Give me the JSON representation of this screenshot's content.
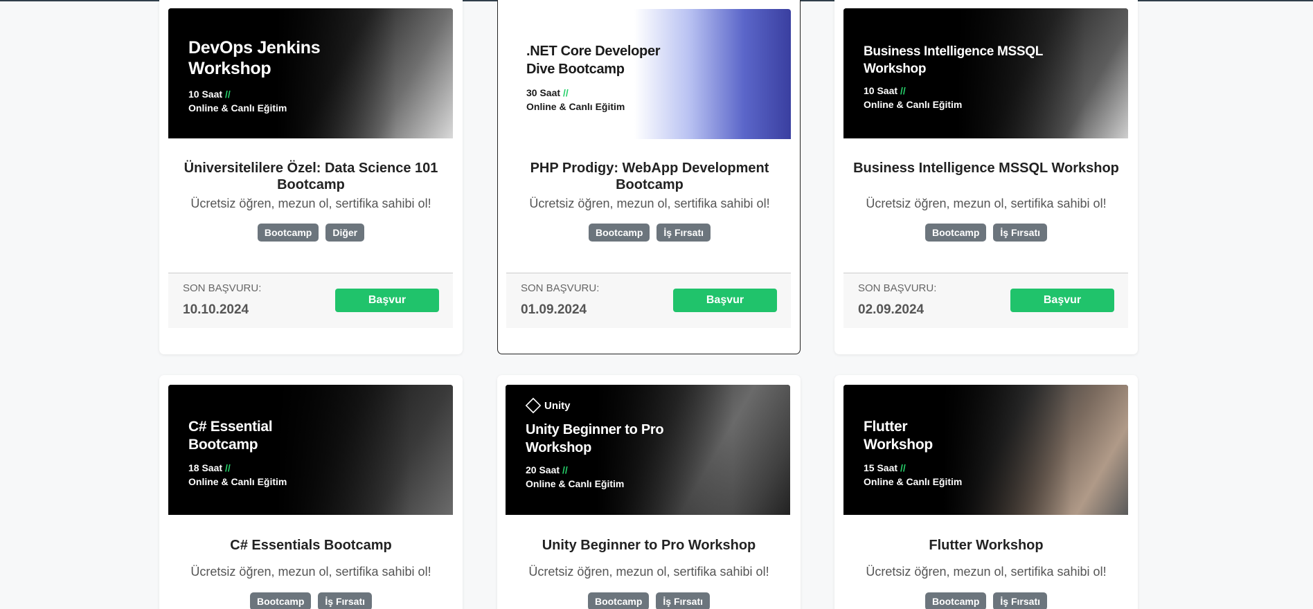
{
  "cards": [
    {
      "banner_title": "DevOps Jenkins\nWorkshop",
      "banner_hours": "10 Saat",
      "banner_mode": "Online & Canlı Eğitim",
      "title": "Üniversitelilere Özel: Data Science 101 Bootcamp",
      "subtitle": "Ücretsiz öğren, mezun ol, sertifika sahibi ol!",
      "tags": [
        "Bootcamp",
        "Diğer"
      ],
      "deadline_label": "SON BAŞVURU:",
      "deadline": "10.10.2024",
      "apply_label": "Başvur"
    },
    {
      "banner_title": ".NET Core Developer\nDive Bootcamp",
      "banner_hours": "30 Saat",
      "banner_mode": "Online & Canlı Eğitim",
      "title": "PHP Prodigy: WebApp Development Bootcamp",
      "subtitle": "Ücretsiz öğren, mezun ol, sertifika sahibi ol!",
      "tags": [
        "Bootcamp",
        "İş Fırsatı"
      ],
      "deadline_label": "SON BAŞVURU:",
      "deadline": "01.09.2024",
      "apply_label": "Başvur"
    },
    {
      "banner_title": "Business Intelligence MSSQL\nWorkshop",
      "banner_hours": "10 Saat",
      "banner_mode": "Online & Canlı Eğitim",
      "title": "Business Intelligence MSSQL Workshop",
      "subtitle": "Ücretsiz öğren, mezun ol, sertifika sahibi ol!",
      "tags": [
        "Bootcamp",
        "İş Fırsatı"
      ],
      "deadline_label": "SON BAŞVURU:",
      "deadline": "02.09.2024",
      "apply_label": "Başvur"
    },
    {
      "banner_title": "C# Essential\nBootcamp",
      "banner_hours": "18 Saat",
      "banner_mode": "Online & Canlı Eğitim",
      "title": "C# Essentials Bootcamp",
      "subtitle": "Ücretsiz öğren, mezun ol, sertifika sahibi ol!",
      "tags": [
        "Bootcamp",
        "İş Fırsatı"
      ]
    },
    {
      "banner_logo": "Unity",
      "banner_title": "Unity Beginner to Pro\nWorkshop",
      "banner_hours": "20 Saat",
      "banner_mode": "Online & Canlı Eğitim",
      "title": "Unity Beginner to Pro Workshop",
      "subtitle": "Ücretsiz öğren, mezun ol, sertifika sahibi ol!",
      "tags": [
        "Bootcamp",
        "İş Fırsatı"
      ]
    },
    {
      "banner_title": "Flutter\nWorkshop",
      "banner_hours": "15 Saat",
      "banner_mode": "Online & Canlı Eğitim",
      "title": "Flutter Workshop",
      "subtitle": "Ücretsiz öğren, mezun ol, sertifika sahibi ol!",
      "tags": [
        "Bootcamp",
        "İş Fırsatı"
      ]
    }
  ],
  "slash": "//",
  "colors": {
    "accent": "#20c36b",
    "tag": "#6c757d",
    "slash": "#26d06a"
  }
}
